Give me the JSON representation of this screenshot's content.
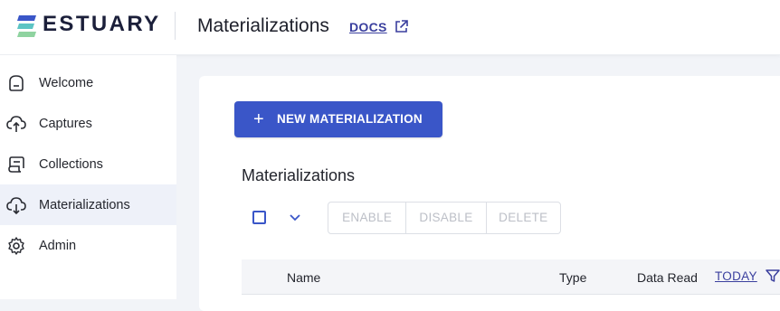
{
  "header": {
    "brand": "ESTUARY",
    "page_title": "Materializations",
    "docs_label": "DOCS",
    "logo_colors": [
      "#3a56c8",
      "#5cc4c4",
      "#8fd3a0"
    ]
  },
  "sidebar": {
    "items": [
      {
        "label": "Welcome",
        "icon": "home-icon",
        "active": false
      },
      {
        "label": "Captures",
        "icon": "cloud-upload-icon",
        "active": false
      },
      {
        "label": "Collections",
        "icon": "scroll-icon",
        "active": false
      },
      {
        "label": "Materializations",
        "icon": "cloud-download-icon",
        "active": true
      },
      {
        "label": "Admin",
        "icon": "gear-icon",
        "active": false
      }
    ]
  },
  "main": {
    "new_button": {
      "icon": "plus-icon",
      "label": "NEW MATERIALIZATION"
    },
    "section_title": "Materializations",
    "toolbar": {
      "select_all_checked": false,
      "actions": [
        "ENABLE",
        "DISABLE",
        "DELETE"
      ]
    },
    "table": {
      "columns": [
        "Name",
        "Type",
        "Data Read"
      ],
      "stats_range_label": "TODAY"
    }
  },
  "colors": {
    "accent": "#3a56c8",
    "active_nav_bg": "#eef1f9",
    "disabled_text": "#bcbfc7"
  }
}
